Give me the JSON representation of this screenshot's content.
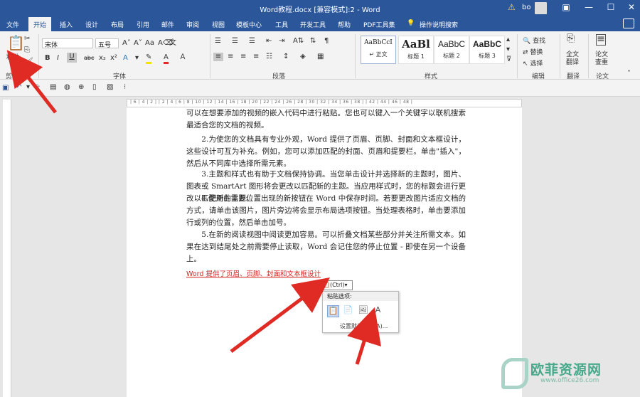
{
  "window": {
    "title": "Word教程.docx [兼容模式]:2 - Word",
    "user": "bo",
    "warn_icon": "warning-icon",
    "min": "—",
    "max": "☐",
    "close": "✕"
  },
  "tabs": [
    "文件",
    "开始",
    "插入",
    "设计",
    "布局",
    "引用",
    "邮件",
    "审阅",
    "视图",
    "模板中心",
    "工具",
    "开发工具",
    "帮助",
    "PDF工具集"
  ],
  "tell_me": "操作说明搜索",
  "ribbon": {
    "paste_label": "粘贴",
    "clipboard_label": "剪贴板",
    "font_name": "宋体",
    "font_size": "五号",
    "font_label": "字体",
    "para_label": "段落",
    "styles_label": "样式",
    "edit_label": "编辑",
    "styles": [
      {
        "preview": "AaBbCcI",
        "name": "↵ 正文"
      },
      {
        "preview": "AaBl",
        "name": "标题 1"
      },
      {
        "preview": "AaBbC",
        "name": "标题 2"
      },
      {
        "preview": "AaBbC",
        "name": "标题 3"
      }
    ],
    "find": "查找",
    "replace": "替换",
    "select": "选择",
    "translate": "全文\n翻译",
    "translate_group": "翻译",
    "paper_check": "论文\n查重",
    "paper_group": "论文",
    "bold": "B",
    "italic": "I",
    "underline": "U",
    "strike": "abc",
    "sub": "x₂",
    "sup": "x²"
  },
  "document": {
    "paragraphs": [
      "可以在想要添加的视频的嵌入代码中进行粘贴。您也可以键入一个关键字以联机搜索最适合您的文档的视频。",
      "　　2.为使您的文档具有专业外观，Word 提供了页眉、页脚、封面和文本框设计，这些设计可互为补充。例如，您可以添加匹配的封面、页眉和提要栏。单击\"插入\"，然后从不同库中选择所需元素。",
      "　　3.主题和样式也有助于文档保持协调。当您单击设计并选择新的主题时，图片、图表或 SmartArt 图形将会更改以匹配新的主题。当应用样式时，您的标题会进行更改以匹配新的主题。",
      "　　4.使用在需要位置出现的新按钮在 Word 中保存时间。若要更改图片适应文档的方式，请单击该图片，图片旁边将会显示布局选项按钮。当处理表格时，单击要添加行或列的位置，然后单击加号。",
      "　　5.在新的阅读视图中阅读更加容易。可以折叠文档某些部分并关注所需文本。如果在达到结尾处之前需要停止读取，Word 会记住您的停止位置 - 即使在另一个设备上。"
    ],
    "pasted_text": "Word 提供了页眉、页脚、封面和文本框设计"
  },
  "paste_popup": {
    "ctrl_label": "(Ctrl)",
    "menu_header": "粘贴选项:",
    "set_default": "设置默认粘贴(A)..."
  },
  "ruler": {
    "marks": "| 6 |   4 |   2 |   | 2 |   4 |   6 |   8 |  10 |  12 |  14 |  16 |  18 |  20 |  22 |  24 |  26 |  28 |  30 |  32 |  34 |  36 |  38 |   | 42 |  44 |  46 |  48 |"
  },
  "watermark": {
    "text": "欧菲资源网",
    "url": "www.office26.com"
  },
  "colors": {
    "accent": "#2b579a",
    "arrow": "#e02a24",
    "pasted_text": "#d6231e"
  }
}
